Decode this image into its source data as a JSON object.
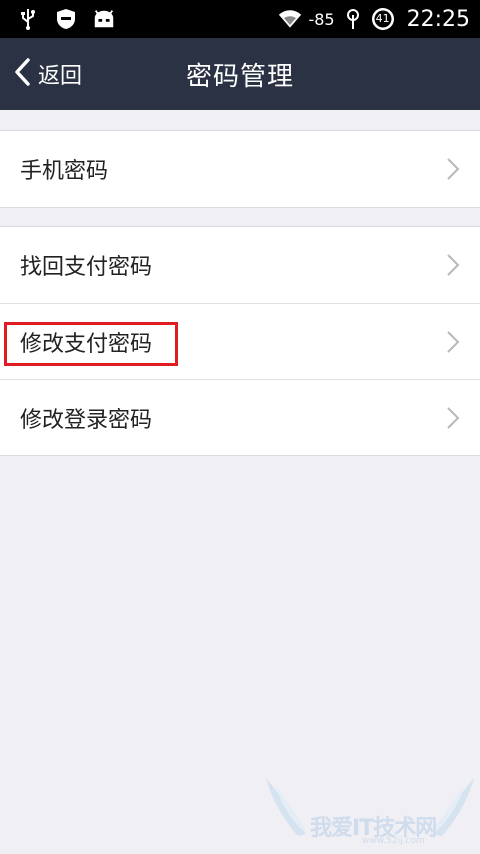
{
  "status_bar": {
    "signal_strength": "-85",
    "battery_level": "41",
    "time": "22:25",
    "icons": [
      "usb-icon",
      "shield-icon",
      "android-icon",
      "wifi-icon",
      "signal-icon",
      "battery-icon"
    ]
  },
  "header": {
    "back_label": "返回",
    "title": "密码管理",
    "background": "#2b3244"
  },
  "groups": [
    {
      "items": [
        {
          "label": "手机密码"
        }
      ]
    },
    {
      "items": [
        {
          "label": "找回支付密码"
        },
        {
          "label": "修改支付密码",
          "highlighted": true
        },
        {
          "label": "修改登录密码"
        }
      ]
    }
  ],
  "highlight_color": "#e11b22",
  "watermark": {
    "text": "我爱IT技术网",
    "url": "www.52ij.com"
  }
}
